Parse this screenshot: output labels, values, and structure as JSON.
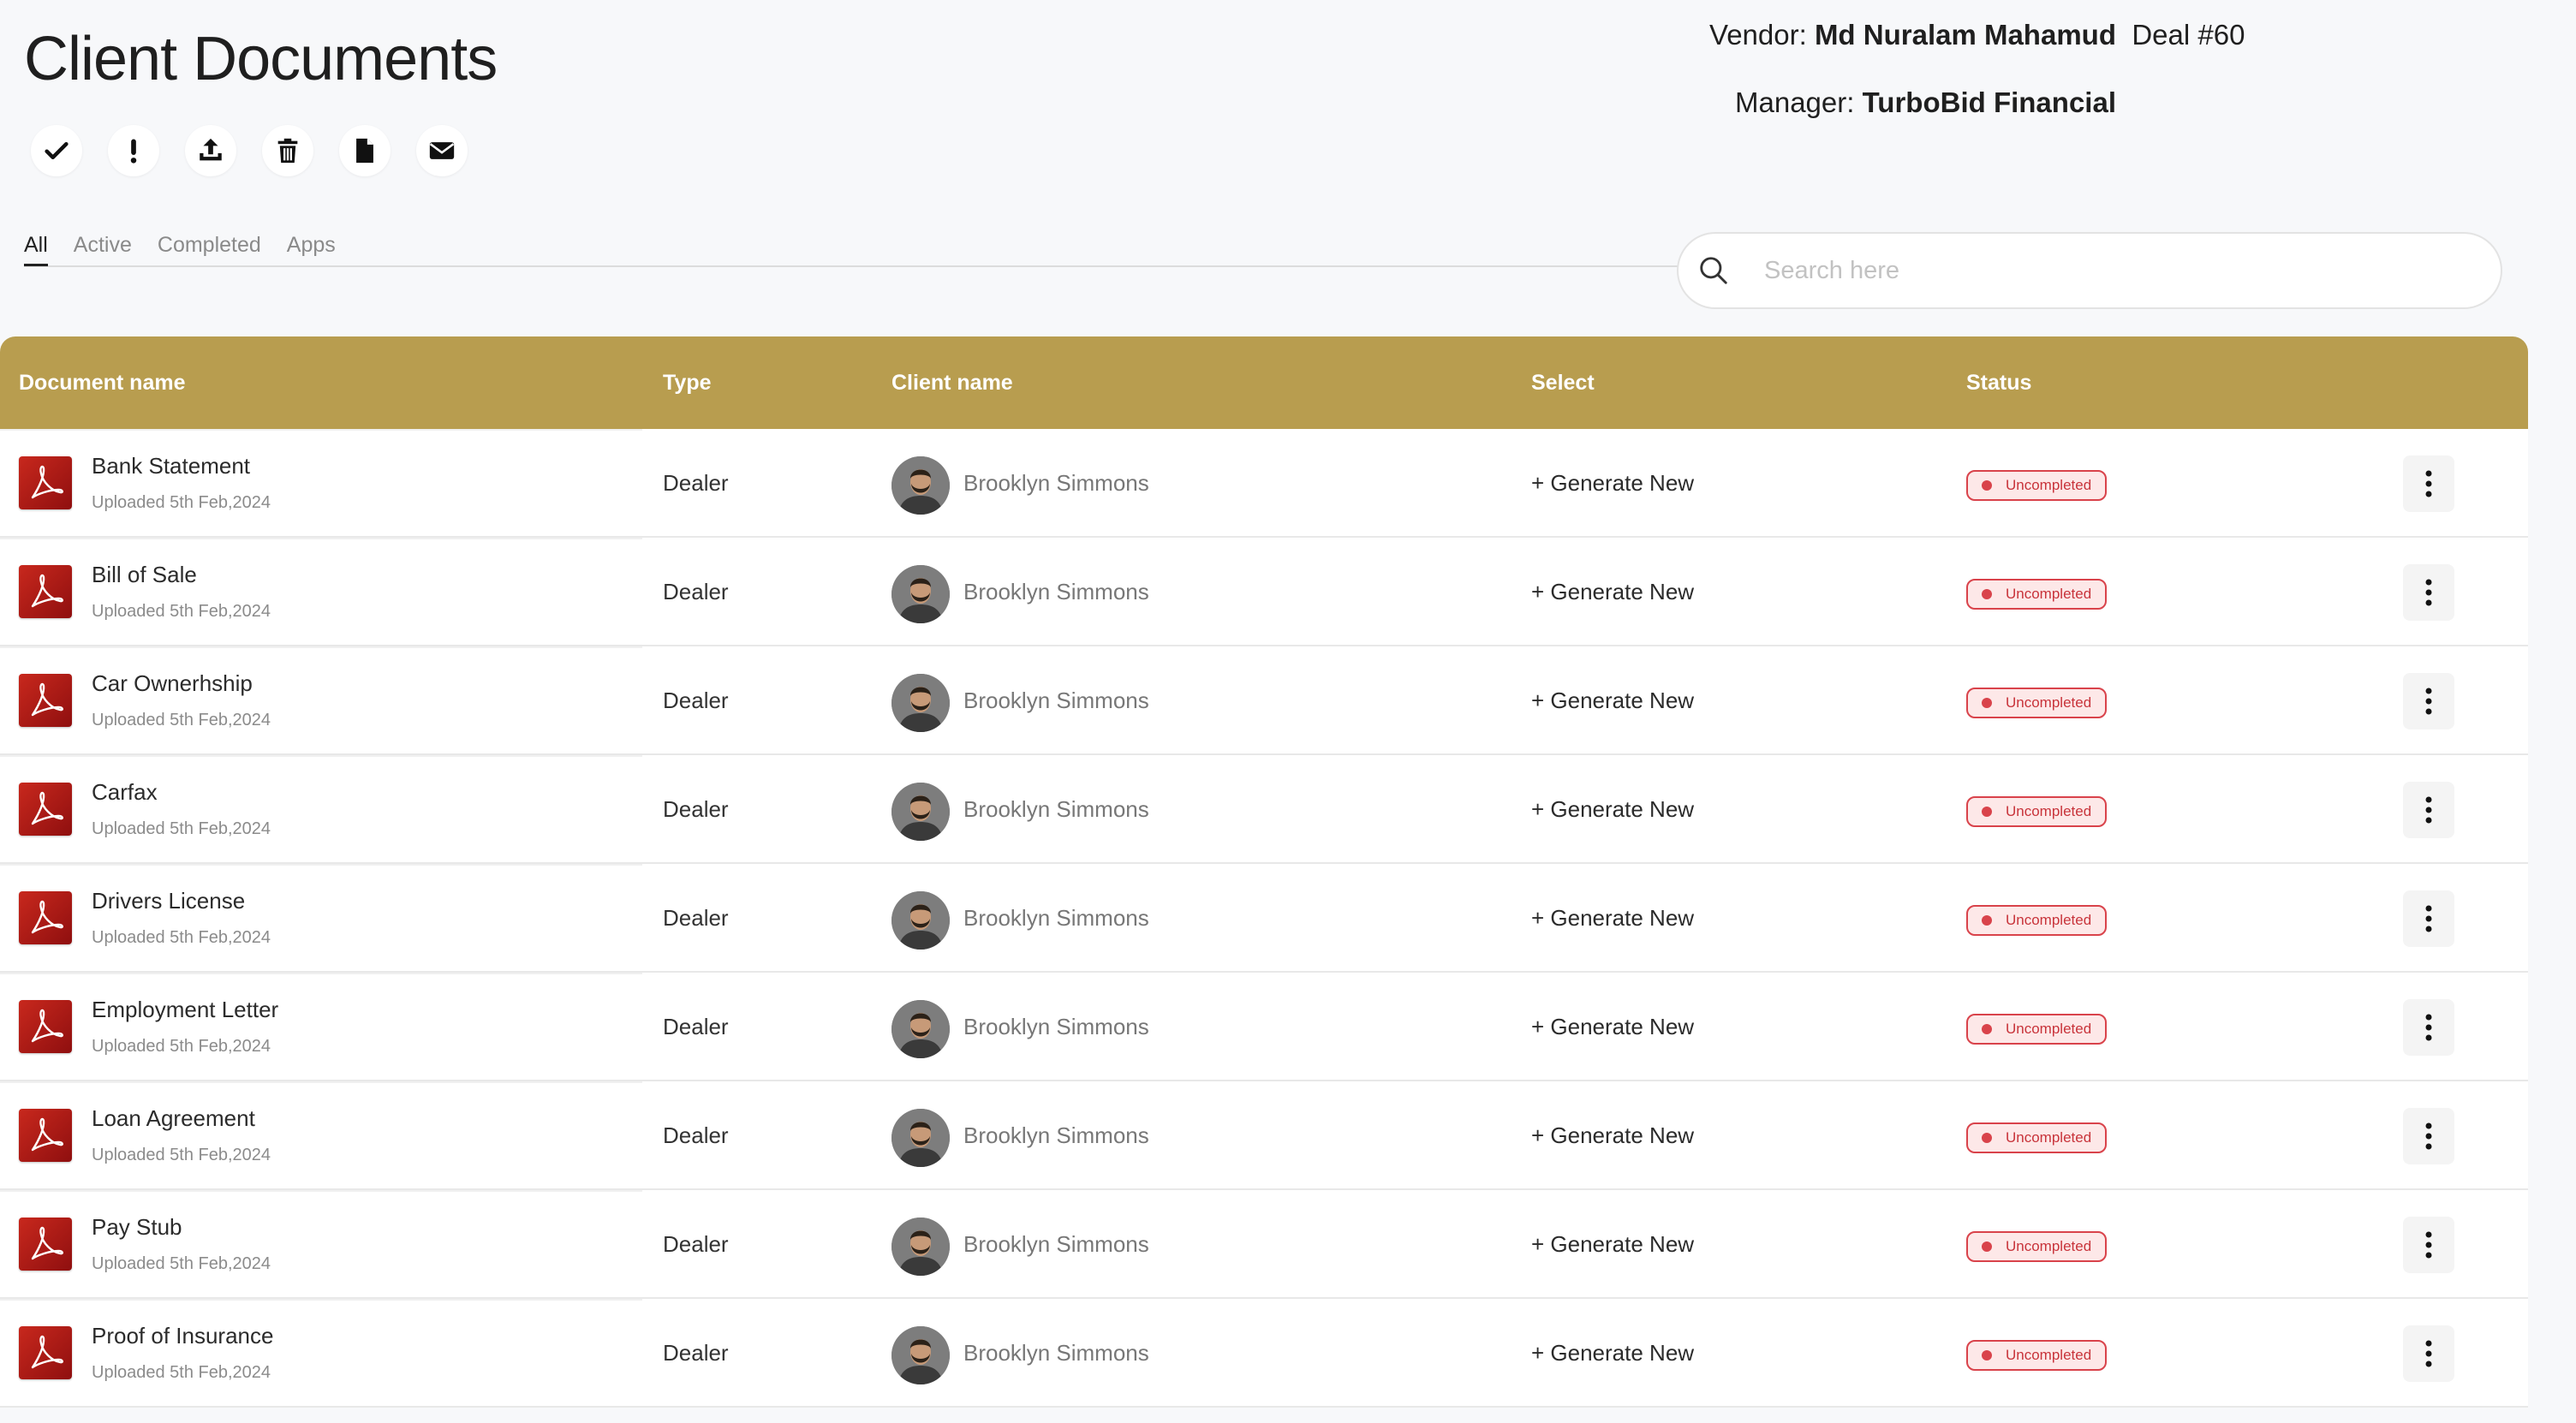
{
  "page": {
    "title": "Client Documents"
  },
  "header": {
    "vendor_label": "Vendor:",
    "vendor_name": "Md Nuralam Mahamud",
    "deal": "Deal #60",
    "manager_label": "Manager:",
    "manager_name": "TurboBid Financial"
  },
  "toolbar": [
    {
      "icon": "check-icon"
    },
    {
      "icon": "exclamation-icon"
    },
    {
      "icon": "upload-icon"
    },
    {
      "icon": "trash-icon"
    },
    {
      "icon": "file-icon"
    },
    {
      "icon": "envelope-icon"
    }
  ],
  "tabs": [
    {
      "label": "All",
      "active": true
    },
    {
      "label": "Active",
      "active": false
    },
    {
      "label": "Completed",
      "active": false
    },
    {
      "label": "Apps",
      "active": false
    }
  ],
  "search": {
    "placeholder": "Search here",
    "value": ""
  },
  "table": {
    "columns": [
      "Document name",
      "Type",
      "Client name",
      "Select",
      "Status"
    ],
    "rows": [
      {
        "name": "Bank Statement",
        "uploaded": "Uploaded 5th Feb,2024",
        "type": "Dealer",
        "client": "Brooklyn Simmons",
        "action": "+ Generate New",
        "status": "Uncompleted"
      },
      {
        "name": "Bill of Sale",
        "uploaded": "Uploaded 5th Feb,2024",
        "type": "Dealer",
        "client": "Brooklyn Simmons",
        "action": "+ Generate New",
        "status": "Uncompleted"
      },
      {
        "name": "Car Ownerhship",
        "uploaded": "Uploaded 5th Feb,2024",
        "type": "Dealer",
        "client": "Brooklyn Simmons",
        "action": "+ Generate New",
        "status": "Uncompleted"
      },
      {
        "name": "Carfax",
        "uploaded": "Uploaded 5th Feb,2024",
        "type": "Dealer",
        "client": "Brooklyn Simmons",
        "action": "+ Generate New",
        "status": "Uncompleted"
      },
      {
        "name": "Drivers License",
        "uploaded": "Uploaded 5th Feb,2024",
        "type": "Dealer",
        "client": "Brooklyn Simmons",
        "action": "+ Generate New",
        "status": "Uncompleted"
      },
      {
        "name": "Employment Letter",
        "uploaded": "Uploaded 5th Feb,2024",
        "type": "Dealer",
        "client": "Brooklyn Simmons",
        "action": "+ Generate New",
        "status": "Uncompleted"
      },
      {
        "name": "Loan Agreement",
        "uploaded": "Uploaded 5th Feb,2024",
        "type": "Dealer",
        "client": "Brooklyn Simmons",
        "action": "+ Generate New",
        "status": "Uncompleted"
      },
      {
        "name": "Pay Stub",
        "uploaded": "Uploaded 5th Feb,2024",
        "type": "Dealer",
        "client": "Brooklyn Simmons",
        "action": "+ Generate New",
        "status": "Uncompleted"
      },
      {
        "name": "Proof of Insurance",
        "uploaded": "Uploaded 5th Feb,2024",
        "type": "Dealer",
        "client": "Brooklyn Simmons",
        "action": "+ Generate New",
        "status": "Uncompleted"
      }
    ]
  },
  "colors": {
    "header_gold": "#b89d4f",
    "status_red": "#d9434b",
    "pdf_red": "#c8281d",
    "background": "#f7f8fa"
  }
}
